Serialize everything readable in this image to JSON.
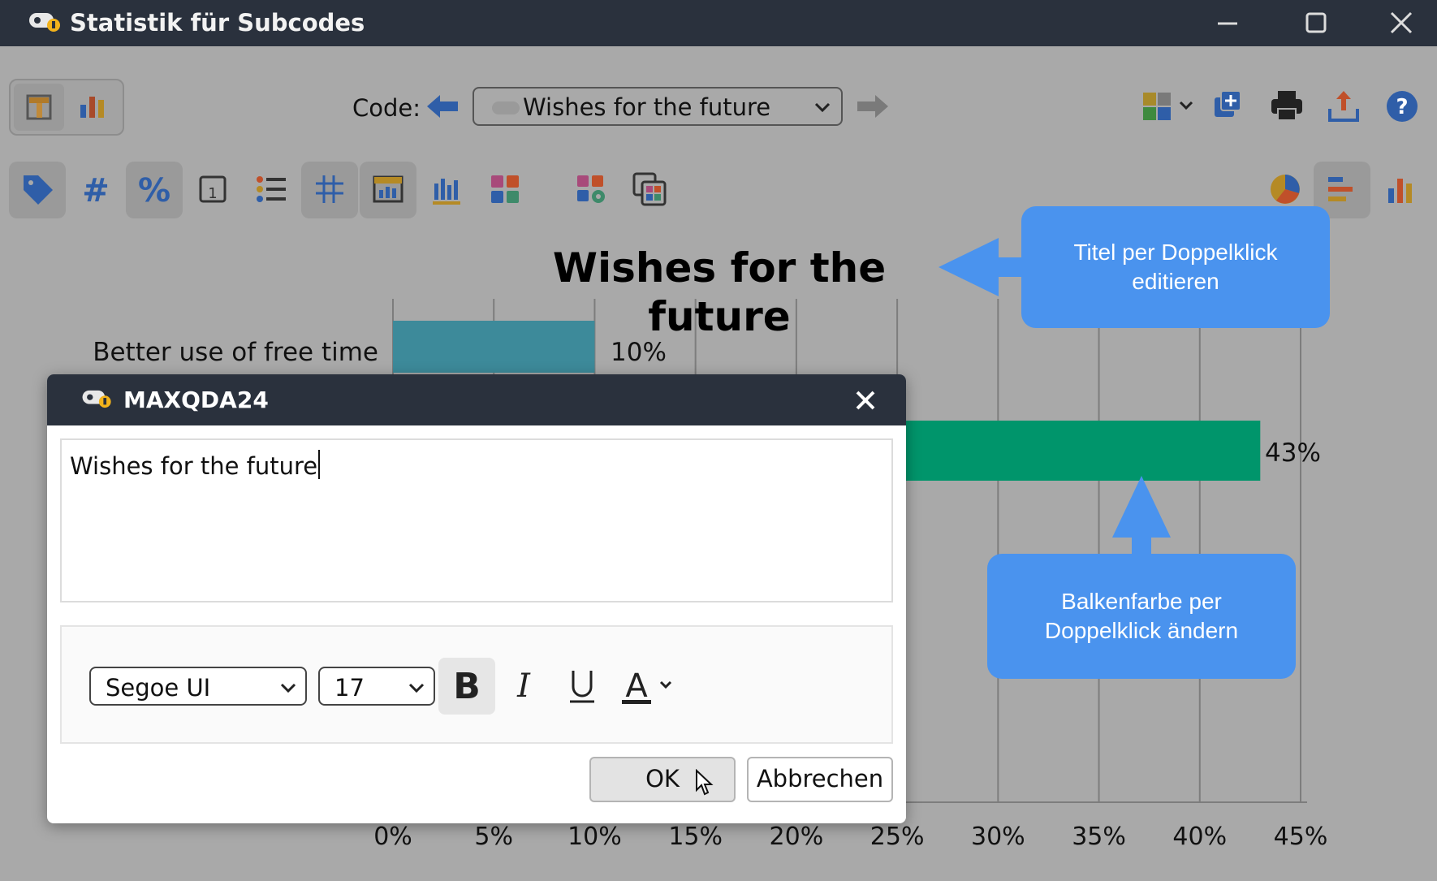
{
  "window": {
    "title": "Statistik für Subcodes",
    "controls": [
      "minimize",
      "maximize",
      "close"
    ]
  },
  "toolbar": {
    "code_label": "Code:",
    "code_value": "Wishes for the future",
    "view_toggle": [
      "table-view-icon",
      "chart-view-icon"
    ]
  },
  "chart_data": {
    "type": "bar",
    "orientation": "horizontal",
    "title": "Wishes for the future",
    "categories": [
      "Better use of free time",
      ""
    ],
    "values": [
      10,
      43
    ],
    "value_labels": [
      "10%",
      "43%"
    ],
    "x_ticks": [
      "0%",
      "5%",
      "10%",
      "15%",
      "20%",
      "25%",
      "30%",
      "35%",
      "40%",
      "45%"
    ],
    "xlim": [
      0,
      45
    ],
    "grid": true,
    "colors": [
      "#3d8a9a",
      "#00956b"
    ]
  },
  "callouts": {
    "title_hint": "Titel per Doppelklick editieren",
    "bar_hint": "Balkenfarbe per Doppelklick ändern"
  },
  "dialog": {
    "title": "MAXQDA24",
    "text_value": "Wishes for the future",
    "font_family": "Segoe UI",
    "font_size": "17",
    "ok_label": "OK",
    "cancel_label": "Abbrechen"
  },
  "colors": {
    "titlebar": "#2a313d",
    "callout": "#4a93ee",
    "accent_blue": "#3a6fd0"
  }
}
